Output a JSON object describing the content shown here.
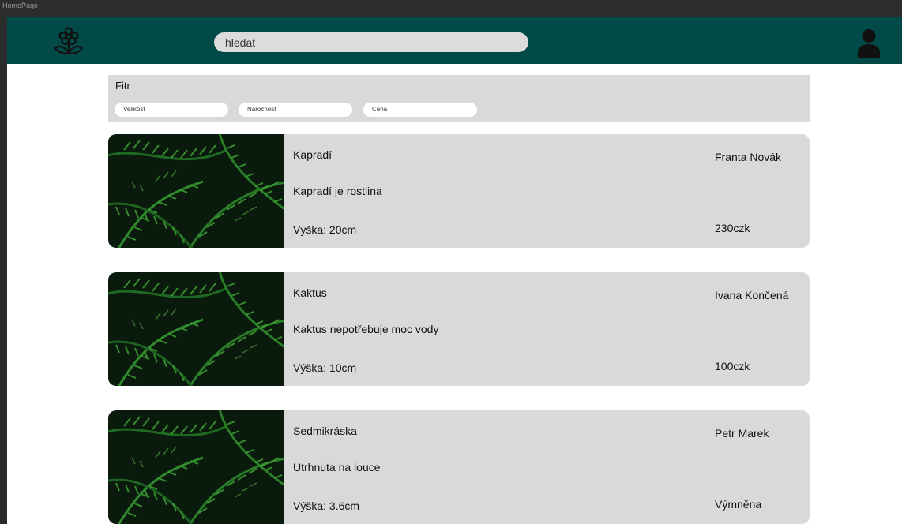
{
  "window": {
    "frame_label": "HomePage"
  },
  "header": {
    "search_placeholder": "hledat",
    "colors": {
      "bar": "#014a47",
      "search_bg": "#dcdcdc"
    },
    "icons": {
      "logo": "flower-icon",
      "profile": "user-icon"
    }
  },
  "filter": {
    "title": "Fitr",
    "options": [
      "Velikost",
      "Náročnost",
      "Cena"
    ]
  },
  "products": [
    {
      "name": "Kapradí",
      "description": "Kapradí je rostlina",
      "height": "Výška: 20cm",
      "author": "Franta Novák",
      "price": "230czk",
      "image": "fern-photo"
    },
    {
      "name": "Kaktus",
      "description": "Kaktus nepotřebuje moc vody",
      "height": "Výška: 10cm",
      "author": "Ivana Končená",
      "price": "100czk",
      "image": "fern-photo"
    },
    {
      "name": "Sedmikráska",
      "description": "Utrhnuta na louce",
      "height": "Výška: 3.6cm",
      "author": "Petr Marek",
      "price": "Výmněna",
      "image": "fern-photo"
    }
  ]
}
